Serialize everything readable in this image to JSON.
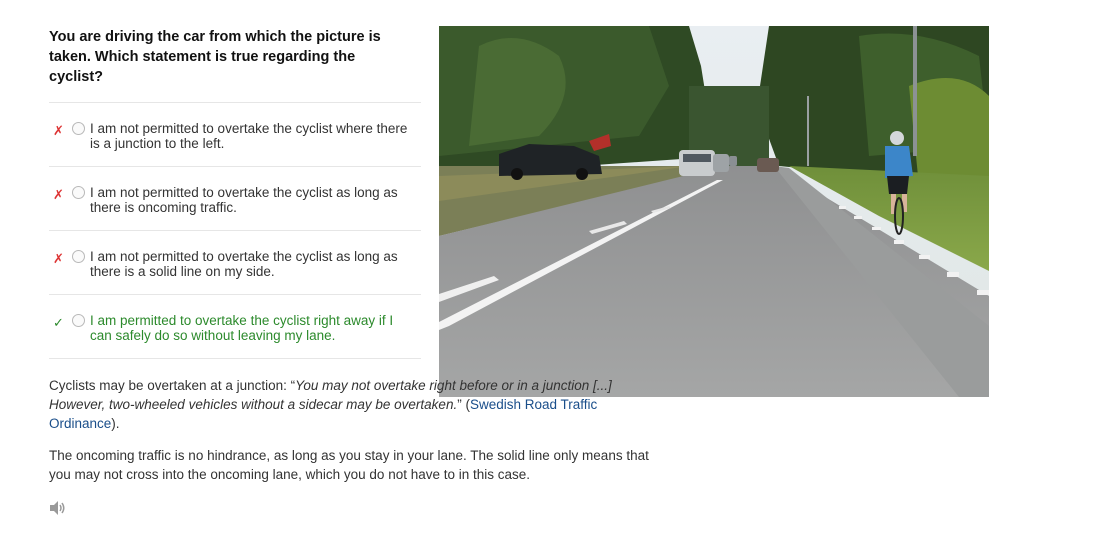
{
  "question": "You are driving the car from which the picture is taken. Which statement is true regarding the cyclist?",
  "options": [
    {
      "mark": "✗",
      "text": "I am not permitted to overtake the cyclist where there is a junction to the left.",
      "correct": false
    },
    {
      "mark": "✗",
      "text": "I am not permitted to overtake the cyclist as long as there is oncoming traffic.",
      "correct": false
    },
    {
      "mark": "✗",
      "text": "I am not permitted to overtake the cyclist as long as there is a solid line on my side.",
      "correct": false
    },
    {
      "mark": "✓",
      "text": "I am permitted to overtake the cyclist right away if I can safely do so without leaving my lane.",
      "correct": true
    }
  ],
  "explanation": {
    "p1_lead": "Cyclists may be overtaken at a junction: “",
    "p1_quote": "You may not overtake right before or in a junction [...] However, two-wheeled vehicles without a sidecar may be overtaken.",
    "p1_mid": "” (",
    "p1_link": "Swedish Road Traffic Ordinance",
    "p1_end": ").",
    "p2": "The oncoming traffic is no hindrance, as long as you stay in your lane. The solid line only means that you may not cross into the oncoming lane, which you do not have to in this case."
  },
  "icons": {
    "sound": "speaker-icon"
  },
  "colors": {
    "wrong": "#dd3333",
    "correct": "#2c8a2c",
    "link": "#1a4e8a"
  }
}
